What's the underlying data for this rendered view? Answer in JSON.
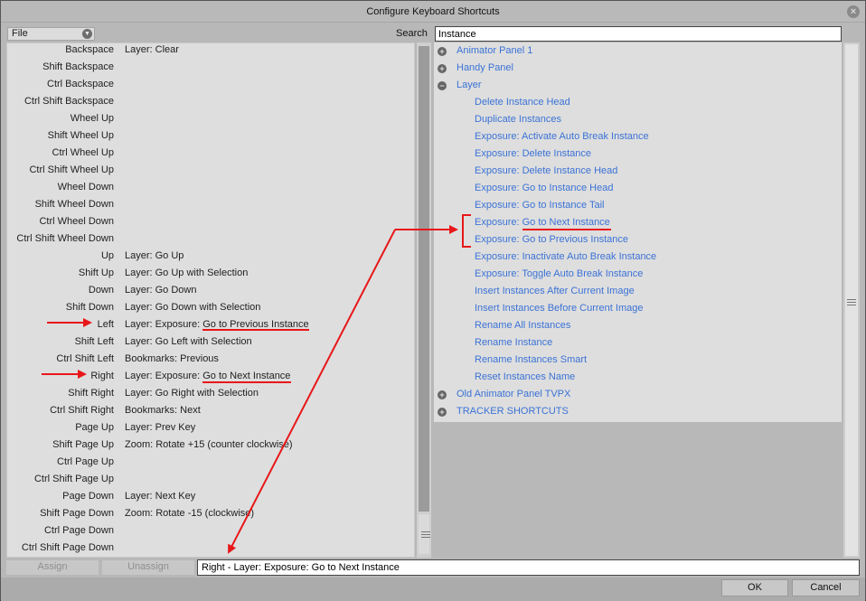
{
  "window": {
    "title": "Configure Keyboard Shortcuts",
    "close_icon": "×"
  },
  "toolbar": {
    "file_value": "File",
    "search_label": "Search",
    "search_value": "Instance"
  },
  "shortcuts": [
    {
      "key": "Backspace",
      "command": "Layer: Clear"
    },
    {
      "key": "Shift Backspace",
      "command": ""
    },
    {
      "key": "Ctrl Backspace",
      "command": ""
    },
    {
      "key": "Ctrl Shift Backspace",
      "command": ""
    },
    {
      "key": "Wheel Up",
      "command": ""
    },
    {
      "key": "Shift Wheel Up",
      "command": ""
    },
    {
      "key": "Ctrl Wheel Up",
      "command": ""
    },
    {
      "key": "Ctrl Shift Wheel Up",
      "command": ""
    },
    {
      "key": "Wheel Down",
      "command": ""
    },
    {
      "key": "Shift Wheel Down",
      "command": ""
    },
    {
      "key": "Ctrl Wheel Down",
      "command": ""
    },
    {
      "key": "Ctrl Shift Wheel Down",
      "command": ""
    },
    {
      "key": "Up",
      "command": "Layer: Go Up"
    },
    {
      "key": "Shift Up",
      "command": "Layer: Go Up with Selection"
    },
    {
      "key": "Down",
      "command": "Layer: Go Down"
    },
    {
      "key": "Shift Down",
      "command": "Layer: Go Down with Selection"
    },
    {
      "key": "Left",
      "command": "Layer: Exposure: Go to Previous Instance"
    },
    {
      "key": "Shift Left",
      "command": "Layer: Go Left with Selection"
    },
    {
      "key": "Ctrl Shift Left",
      "command": "Bookmarks: Previous"
    },
    {
      "key": "Right",
      "command": "Layer: Exposure: Go to Next Instance"
    },
    {
      "key": "Shift Right",
      "command": "Layer: Go Right with Selection"
    },
    {
      "key": "Ctrl Shift Right",
      "command": "Bookmarks: Next"
    },
    {
      "key": "Page Up",
      "command": "Layer: Prev Key"
    },
    {
      "key": "Shift Page Up",
      "command": "Zoom: Rotate +15 (counter clockwise)"
    },
    {
      "key": "Ctrl Page Up",
      "command": ""
    },
    {
      "key": "Ctrl Shift Page Up",
      "command": ""
    },
    {
      "key": "Page Down",
      "command": "Layer: Next Key"
    },
    {
      "key": "Shift Page Down",
      "command": "Zoom: Rotate -15 (clockwise)"
    },
    {
      "key": "Ctrl Page Down",
      "command": ""
    },
    {
      "key": "Ctrl Shift Page Down",
      "command": ""
    }
  ],
  "tree": [
    {
      "label": "Animator Panel 1",
      "level": "top",
      "expander": "+"
    },
    {
      "label": "Handy Panel",
      "level": "top",
      "expander": "+"
    },
    {
      "label": "Layer",
      "level": "top",
      "expander": "−"
    },
    {
      "label": "Delete Instance Head",
      "level": "child"
    },
    {
      "label": "Duplicate Instances",
      "level": "child"
    },
    {
      "label": "Exposure: Activate Auto Break Instance",
      "level": "child"
    },
    {
      "label": "Exposure: Delete Instance",
      "level": "child"
    },
    {
      "label": "Exposure: Delete Instance Head",
      "level": "child"
    },
    {
      "label": "Exposure: Go to Instance Head",
      "level": "child"
    },
    {
      "label": "Exposure: Go to Instance Tail",
      "level": "child"
    },
    {
      "label": "Exposure: Go to Next Instance",
      "level": "child"
    },
    {
      "label": "Exposure: Go to Previous Instance",
      "level": "child"
    },
    {
      "label": "Exposure: Inactivate Auto Break Instance",
      "level": "child"
    },
    {
      "label": "Exposure: Toggle Auto Break Instance",
      "level": "child"
    },
    {
      "label": "Insert Instances After Current Image",
      "level": "child"
    },
    {
      "label": "Insert Instances Before Current Image",
      "level": "child"
    },
    {
      "label": "Rename All Instances",
      "level": "child"
    },
    {
      "label": "Rename Instance",
      "level": "child"
    },
    {
      "label": "Rename Instances Smart",
      "level": "child"
    },
    {
      "label": "Reset Instances Name",
      "level": "child"
    },
    {
      "label": "Old Animator Panel TVPX",
      "level": "top",
      "expander": "+"
    },
    {
      "label": "TRACKER SHORTCUTS",
      "level": "top",
      "expander": "+"
    }
  ],
  "actions": {
    "assign_label": "Assign",
    "unassign_label": "Unassign",
    "status_text": "Right - Layer: Exposure: Go to Next Instance",
    "ok_label": "OK",
    "cancel_label": "Cancel"
  },
  "colors": {
    "link": "#3b72d6",
    "annotation": "#e8171a"
  }
}
